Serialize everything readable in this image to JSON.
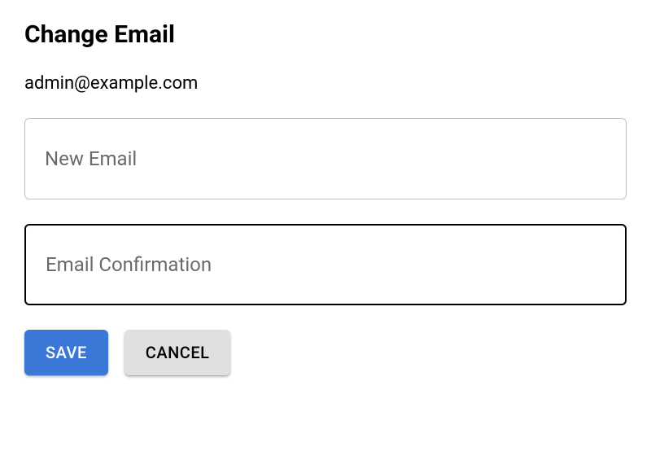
{
  "title": "Change Email",
  "current_email": "admin@example.com",
  "fields": {
    "new_email": {
      "placeholder": "New Email",
      "value": ""
    },
    "email_confirmation": {
      "placeholder": "Email Confirmation",
      "value": ""
    }
  },
  "buttons": {
    "save": "Save",
    "cancel": "Cancel"
  }
}
